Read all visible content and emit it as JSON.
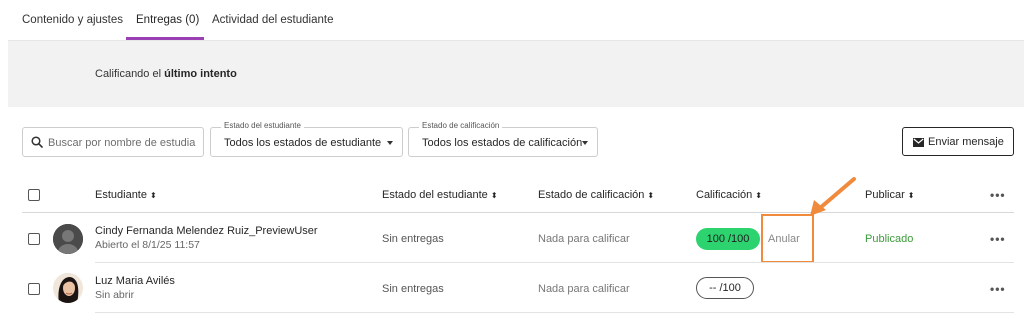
{
  "tabs": [
    {
      "label": "Contenido y ajustes"
    },
    {
      "label": "Entregas (0)"
    },
    {
      "label": "Actividad del estudiante"
    }
  ],
  "banner": {
    "prefix": "Calificando el ",
    "emphasis": "último intento"
  },
  "toolbar": {
    "search_placeholder": "Buscar por nombre de estudia",
    "student_status": {
      "legend": "Estado del estudiante",
      "value": "Todos los estados de estudiante"
    },
    "grading_status": {
      "legend": "Estado de calificación",
      "value": "Todos los estados de calificación"
    },
    "send_message": "Enviar mensaje"
  },
  "table": {
    "headers": {
      "student": "Estudiante",
      "student_status": "Estado del estudiante",
      "grading_status": "Estado de calificación",
      "grade": "Calificación",
      "publish": "Publicar",
      "sort_glyph": "⬍",
      "more": "•••"
    },
    "rows": [
      {
        "name": "Cindy Fernanda Melendez Ruiz_PreviewUser",
        "sub": "Abierto el 8/1/25 11:57",
        "student_status": "Sin entregas",
        "grading_status": "Nada para calificar",
        "grade": "100  /100",
        "override": "Anular",
        "publish": "Publicado"
      },
      {
        "name": "Luz Maria Avilés",
        "sub": "Sin abrir",
        "student_status": "Sin entregas",
        "grading_status": "Nada para calificar",
        "grade": "--  /100"
      }
    ]
  },
  "colors": {
    "accent_tab": "#9b3fb5",
    "grade_green": "#2dd36f",
    "annotation_orange": "#f08a3c",
    "published_green": "#3c9b3c"
  },
  "icons": [
    "search-icon",
    "caret-down-icon",
    "envelope-icon",
    "sort-icon",
    "more-icon",
    "arrow-annotation"
  ]
}
